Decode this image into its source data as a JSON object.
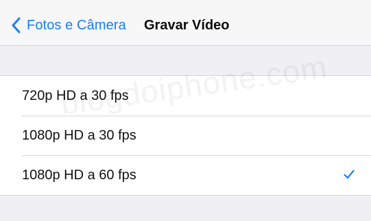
{
  "navbar": {
    "back_label": "Fotos e Câmera",
    "title": "Gravar Vídeo"
  },
  "options": [
    {
      "label": "720p HD a 30 fps",
      "selected": false
    },
    {
      "label": "1080p HD a 30 fps",
      "selected": false
    },
    {
      "label": "1080p HD a 60 fps",
      "selected": true
    }
  ],
  "watermark": "blogdoiphone.com",
  "colors": {
    "accent": "#1a7cf5",
    "background": "#efeff4"
  },
  "icons": {
    "back": "chevron-left-icon",
    "selected": "checkmark-icon"
  }
}
